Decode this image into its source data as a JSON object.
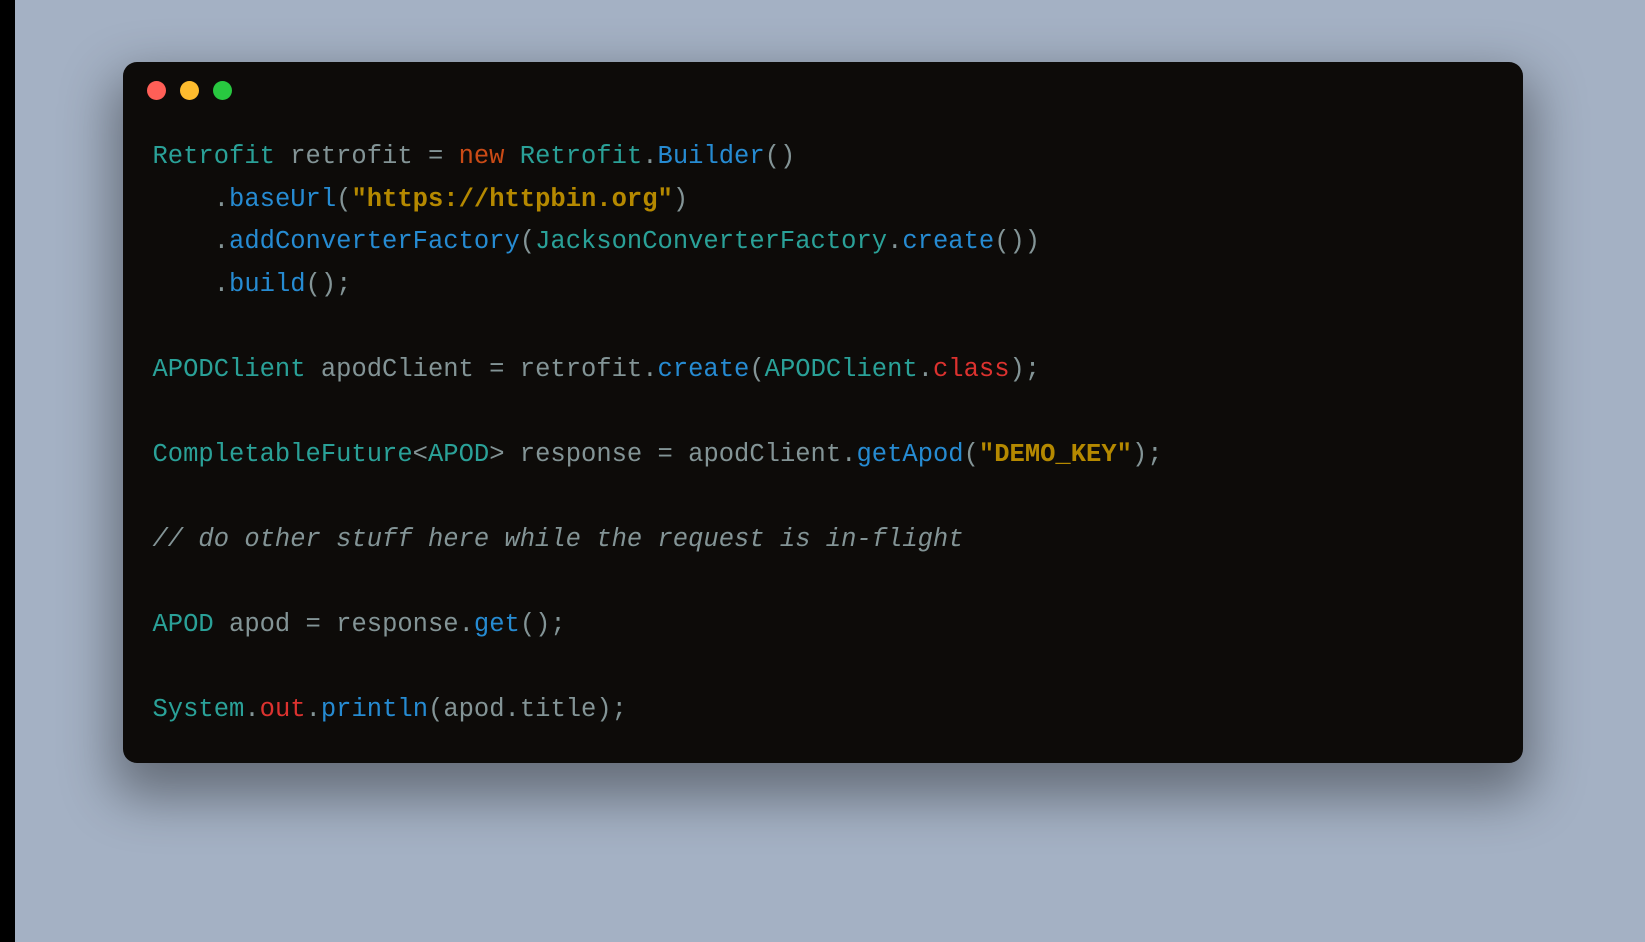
{
  "code": {
    "l1_type1": "Retrofit",
    "l1_ident": " retrofit ",
    "l1_eq": "= ",
    "l1_new": "new",
    "l1_type2": " Retrofit",
    "l1_dot": ".",
    "l1_call": "Builder",
    "l1_paren": "()",
    "l2_indent": "    ",
    "l2_dot": ".",
    "l2_call": "baseUrl",
    "l2_p1": "(",
    "l2_str": "\"https://httpbin.org\"",
    "l2_p2": ")",
    "l3_indent": "    ",
    "l3_dot": ".",
    "l3_call": "addConverterFactory",
    "l3_p1": "(",
    "l3_type": "JacksonConverterFactory",
    "l3_dot2": ".",
    "l3_call2": "create",
    "l3_p2": "())",
    "l4_indent": "    ",
    "l4_dot": ".",
    "l4_call": "build",
    "l4_p": "();",
    "l6_type": "APODClient",
    "l6_ident": " apodClient ",
    "l6_eq": "= ",
    "l6_obj": "retrofit",
    "l6_dot": ".",
    "l6_call": "create",
    "l6_p1": "(",
    "l6_type2": "APODClient",
    "l6_dot2": ".",
    "l6_class": "class",
    "l6_p2": ");",
    "l8_type": "CompletableFuture",
    "l8_lt": "<",
    "l8_type2": "APOD",
    "l8_gt": ">",
    "l8_ident": " response ",
    "l8_eq": "= ",
    "l8_obj": "apodClient",
    "l8_dot": ".",
    "l8_call": "getApod",
    "l8_p1": "(",
    "l8_str": "\"DEMO_KEY\"",
    "l8_p2": ");",
    "l10_comment": "// do other stuff here while the request is in-flight",
    "l12_type": "APOD",
    "l12_ident": " apod ",
    "l12_eq": "= ",
    "l12_obj": "response",
    "l12_dot": ".",
    "l12_call": "get",
    "l12_p": "();",
    "l14_type": "System",
    "l14_dot": ".",
    "l14_out": "out",
    "l14_dot2": ".",
    "l14_call": "println",
    "l14_p1": "(",
    "l14_obj": "apod",
    "l14_dot3": ".",
    "l14_field": "title",
    "l14_p2": ");"
  }
}
